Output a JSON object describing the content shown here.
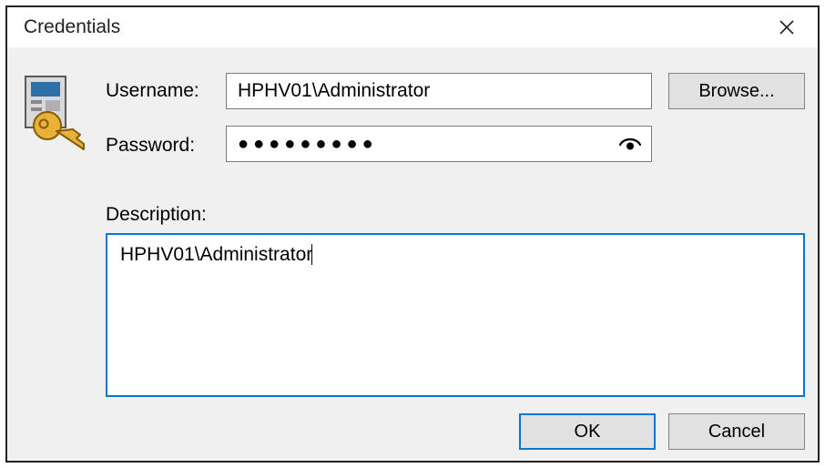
{
  "window": {
    "title": "Credentials"
  },
  "labels": {
    "username": "Username:",
    "password": "Password:",
    "description": "Description:"
  },
  "fields": {
    "username_value": "HPHV01\\Administrator",
    "password_mask": "●●●●●●●●●",
    "description_value": "HPHV01\\Administrator"
  },
  "buttons": {
    "browse": "Browse...",
    "ok": "OK",
    "cancel": "Cancel"
  },
  "icons": {
    "credentials": "credentials-icon",
    "reveal": "eye-icon",
    "close": "close-icon"
  }
}
